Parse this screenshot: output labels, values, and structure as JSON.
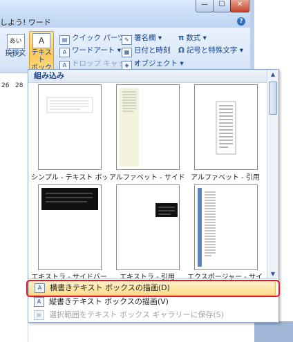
{
  "window": {
    "title": "しよう! ワード",
    "help_glyph": "?",
    "min_glyph": "—",
    "max_glyph": "☐",
    "close_glyph": "✕"
  },
  "ribbon": {
    "greeting_icon": "あいさつ",
    "greeting_label": "挨拶文",
    "textbox_icon": "A",
    "textbox_label_1": "テキスト",
    "textbox_label_2": "ボックス",
    "quick_parts": "クイック パーツ",
    "wordart": "ワードアート",
    "drop_cap": "ドロップ キャップ",
    "signature": "署名欄",
    "datetime": "日付と時刻",
    "object": "オブジェクト",
    "equation_symbol": "π",
    "equation": "数式",
    "symbol_symbol": "Ω",
    "symbol": "記号と特殊文字"
  },
  "ruler": {
    "n1": "26",
    "n2": "28"
  },
  "gallery": {
    "header": "組み込み",
    "thumbnails": [
      {
        "label": "シンプル - テキスト ボッ..."
      },
      {
        "label": "アルファベット - サイドバー"
      },
      {
        "label": "アルファベット - 引用"
      },
      {
        "label": "エキストラ - サイドバー"
      },
      {
        "label": "エキストラ - 引用"
      },
      {
        "label": "エクスポージャー - サイドバー"
      }
    ]
  },
  "menu": {
    "draw_horizontal": "横書きテキスト ボックスの描画(D)",
    "draw_vertical": "縦書きテキスト ボックスの描画(V)",
    "save_selection": "選択範囲をテキスト ボックス ギャラリーに保存(S)"
  }
}
